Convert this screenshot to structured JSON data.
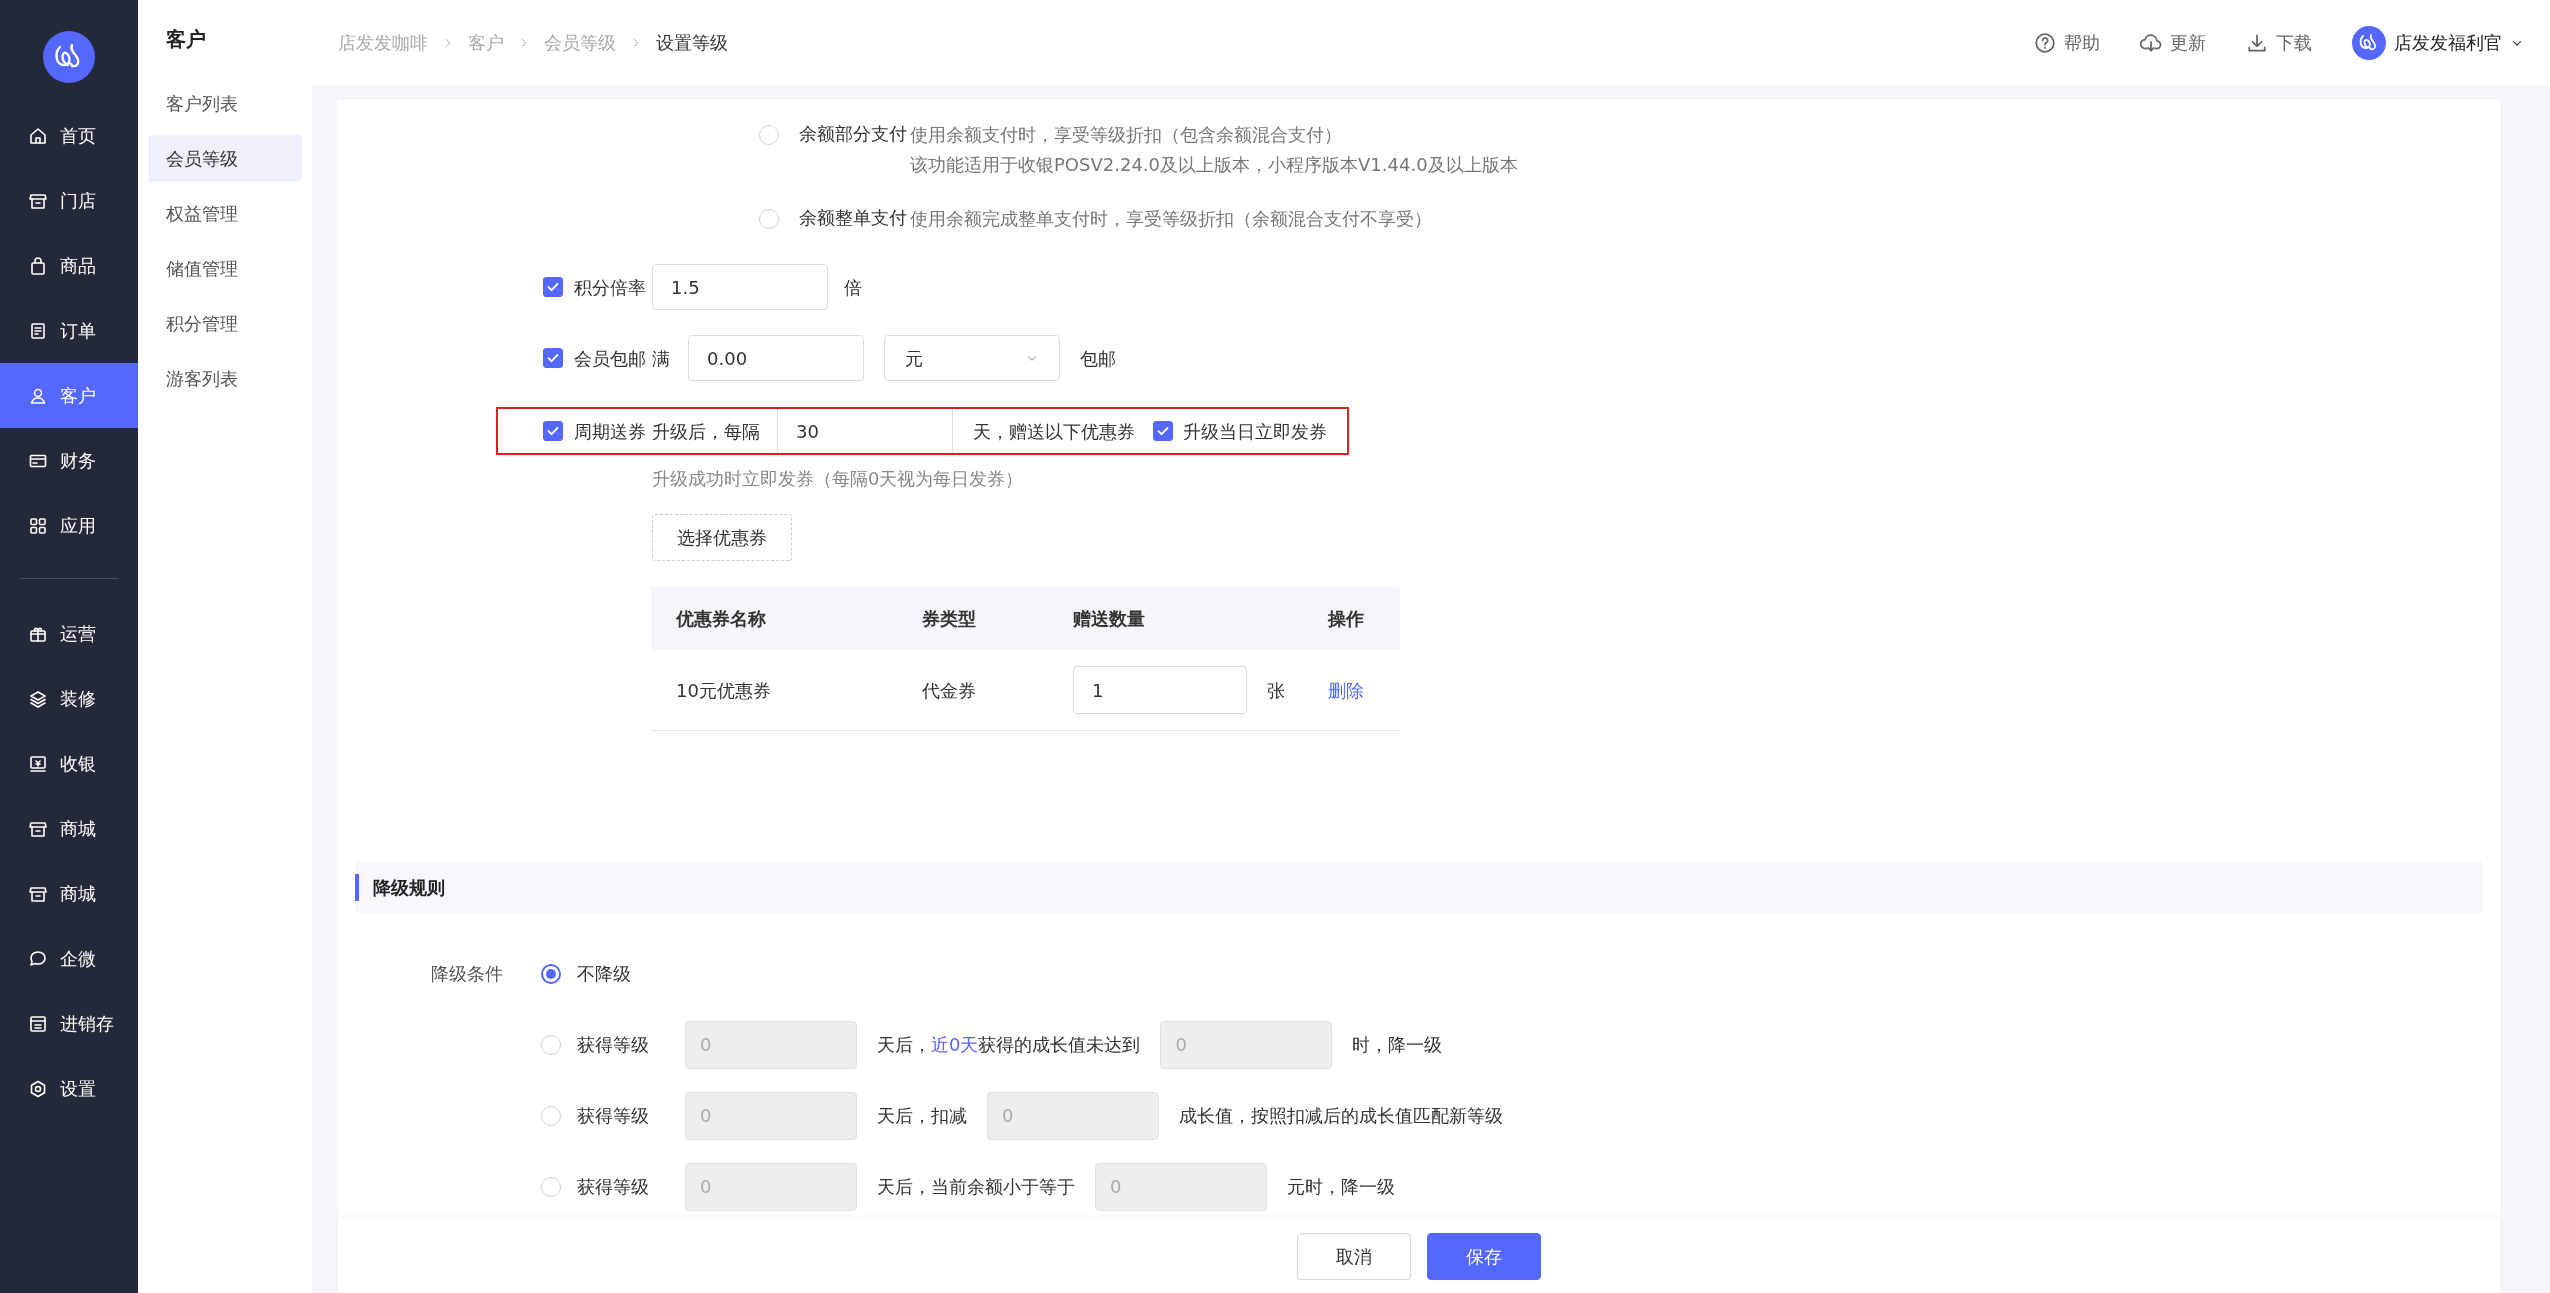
{
  "sidebar": {
    "groups": [
      {
        "items": [
          {
            "label": "首页",
            "selected": false
          },
          {
            "label": "门店",
            "selected": false
          },
          {
            "label": "商品",
            "selected": false
          },
          {
            "label": "订单",
            "selected": false
          },
          {
            "label": "客户",
            "selected": true
          },
          {
            "label": "财务",
            "selected": false
          },
          {
            "label": "应用",
            "selected": false
          }
        ]
      },
      {
        "items": [
          {
            "label": "运营",
            "selected": false
          },
          {
            "label": "装修",
            "selected": false
          },
          {
            "label": "收银",
            "selected": false
          },
          {
            "label": "商城",
            "selected": false
          },
          {
            "label": "商城",
            "selected": false
          },
          {
            "label": "企微",
            "selected": false
          },
          {
            "label": "进销存",
            "selected": false
          },
          {
            "label": "设置",
            "selected": false
          }
        ]
      }
    ]
  },
  "submenu": {
    "title": "客户",
    "items": [
      {
        "label": "客户列表",
        "selected": false
      },
      {
        "label": "会员等级",
        "selected": true
      },
      {
        "label": "权益管理",
        "selected": false
      },
      {
        "label": "储值管理",
        "selected": false
      },
      {
        "label": "积分管理",
        "selected": false
      },
      {
        "label": "游客列表",
        "selected": false
      }
    ]
  },
  "header": {
    "breadcrumb": [
      "店发发咖啡",
      "客户",
      "会员等级",
      "设置等级"
    ],
    "actions": [
      {
        "label": "帮助"
      },
      {
        "label": "更新"
      },
      {
        "label": "下载"
      }
    ],
    "user": "店发发福利官"
  },
  "balance_options": [
    {
      "label": "余额部分支付",
      "selected": false,
      "description": [
        "使用余额支付时，享受等级折扣（包含余额混合支付）",
        "该功能适用于收银POSV2.24.0及以上版本，小程序版本V1.44.0及以上版本"
      ]
    },
    {
      "label": "余额整单支付",
      "selected": false,
      "description": [
        "使用余额完成整单支付时，享受等级折扣（余额混合支付不享受）"
      ]
    }
  ],
  "points_rate": {
    "checked": true,
    "label": "积分倍率",
    "value": "1.5",
    "unit": "倍"
  },
  "free_shipping": {
    "checked": true,
    "label": "会员包邮",
    "prefix": "满",
    "value": "0.00",
    "select_value": "元",
    "suffix": "包邮"
  },
  "periodic_coupon": {
    "checked": true,
    "highlighted": true,
    "label": "周期送券",
    "prefix": "升级后，每隔",
    "value": "30",
    "suffix": "天，赠送以下优惠券",
    "immediate": {
      "checked": true,
      "label": "升级当日立即发券"
    },
    "hint": "升级成功时立即发券（每隔0天视为每日发券）"
  },
  "select_coupon_button": "选择优惠券",
  "coupon_table": {
    "columns": [
      "优惠券名称",
      "券类型",
      "赠送数量",
      "操作"
    ],
    "rows": [
      {
        "name": "10元优惠券",
        "type": "代金券",
        "quantity": "1",
        "unit": "张",
        "action": "删除"
      }
    ]
  },
  "downgrade": {
    "title": "降级规则",
    "label": "降级条件",
    "options": [
      {
        "selected": true,
        "label": "不降级"
      },
      {
        "selected": false,
        "label": "获得等级",
        "segments": [
          {
            "kind": "input",
            "value": "0",
            "disabled": true
          },
          {
            "kind": "text",
            "text": "天后，"
          },
          {
            "kind": "link",
            "text": "近0天"
          },
          {
            "kind": "text",
            "text": "获得的成长值未达到"
          },
          {
            "kind": "input",
            "value": "0",
            "disabled": true
          },
          {
            "kind": "text",
            "text": "时，降一级"
          }
        ]
      },
      {
        "selected": false,
        "label": "获得等级",
        "segments": [
          {
            "kind": "input",
            "value": "0",
            "disabled": true
          },
          {
            "kind": "text",
            "text": "天后，扣减"
          },
          {
            "kind": "input",
            "value": "0",
            "disabled": true
          },
          {
            "kind": "text",
            "text": "成长值，按照扣减后的成长值匹配新等级"
          }
        ]
      },
      {
        "selected": false,
        "label": "获得等级",
        "segments": [
          {
            "kind": "input",
            "value": "0",
            "disabled": true
          },
          {
            "kind": "text",
            "text": "天后，当前余额小于等于"
          },
          {
            "kind": "input",
            "value": "0",
            "disabled": true
          },
          {
            "kind": "text",
            "text": "元时，降一级"
          }
        ]
      }
    ]
  },
  "footer": {
    "buttons": [
      {
        "label": "取消",
        "kind": "secondary"
      },
      {
        "label": "保存",
        "kind": "primary"
      }
    ]
  }
}
